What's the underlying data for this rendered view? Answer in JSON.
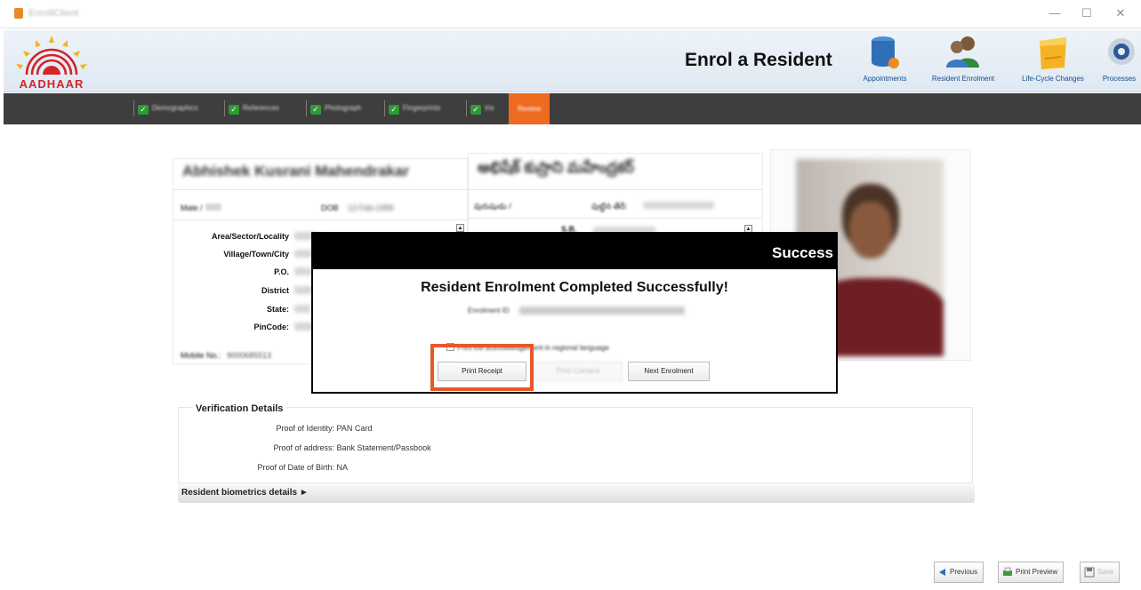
{
  "window": {
    "title": "EnrollClient",
    "minimize_label": "—",
    "maximize_label": "☐",
    "close_label": "✕"
  },
  "header": {
    "logo_text": "AADHAAR",
    "page_title": "Enrol a Resident",
    "modules": [
      {
        "label": "Appointments",
        "icon": "database-icon"
      },
      {
        "label": "Resident Enrolment",
        "icon": "users-icon"
      },
      {
        "label": "Life-Cycle Changes",
        "icon": "folder-icon"
      },
      {
        "label": "Processes",
        "icon": "gear-icon"
      }
    ]
  },
  "tabs": [
    {
      "label": "Demographics",
      "done": true
    },
    {
      "label": "References",
      "done": true
    },
    {
      "label": "Photograph",
      "done": true
    },
    {
      "label": "Fingerprints",
      "done": true
    },
    {
      "label": "Iris",
      "done": true
    },
    {
      "label": "Review",
      "done": false,
      "active": true
    }
  ],
  "review": {
    "name_en": "Abhishek Kusrani Mahendrakar",
    "name_regional": "అభిషేక్ కుస్రాని మహేంద్రకర్",
    "gender_label": "Male /",
    "dob_label": "DOB",
    "dob_value": "12-Feb-1999",
    "gender_regional_label": "పురుషుడు /",
    "dob_regional_label": "పుట్టిన తేదీ:",
    "co_regional_label": "S.B.",
    "address_labels": [
      "Area/Sector/Locality",
      "Village/Town/City",
      "P.O.",
      "District",
      "State:",
      "PinCode:"
    ],
    "mobile_label": "Mobile No.:",
    "mobile_value": "9000685513"
  },
  "verification": {
    "title": "Verification Details",
    "rows": [
      {
        "key": "Proof of Identity:",
        "value": "PAN Card"
      },
      {
        "key": "Proof of address:",
        "value": "Bank Statement/Passbook"
      },
      {
        "key": "Proof of Date of Birth:",
        "value": "NA"
      }
    ]
  },
  "biometrics": {
    "label": "Resident biometrics details ►"
  },
  "footer": {
    "previous_label": "Previous",
    "print_preview_label": "Print Preview",
    "save_label": "Save"
  },
  "dialog": {
    "title": "Success",
    "message": "Resident Enrolment Completed Successfully!",
    "enrolment_id_label": "Enrolment ID",
    "regional_option_label": "Print the acknowledgement in regional language",
    "print_receipt_label": "Print Receipt",
    "print_consent_label": "Print Consent",
    "next_enrolment_label": "Next Enrolment"
  },
  "colors": {
    "accent": "#ee6a1e",
    "navbar": "#3e3e3e",
    "check_green": "#2e9a34",
    "highlight": "#e8572a",
    "aadhaar_red": "#d4242c"
  }
}
